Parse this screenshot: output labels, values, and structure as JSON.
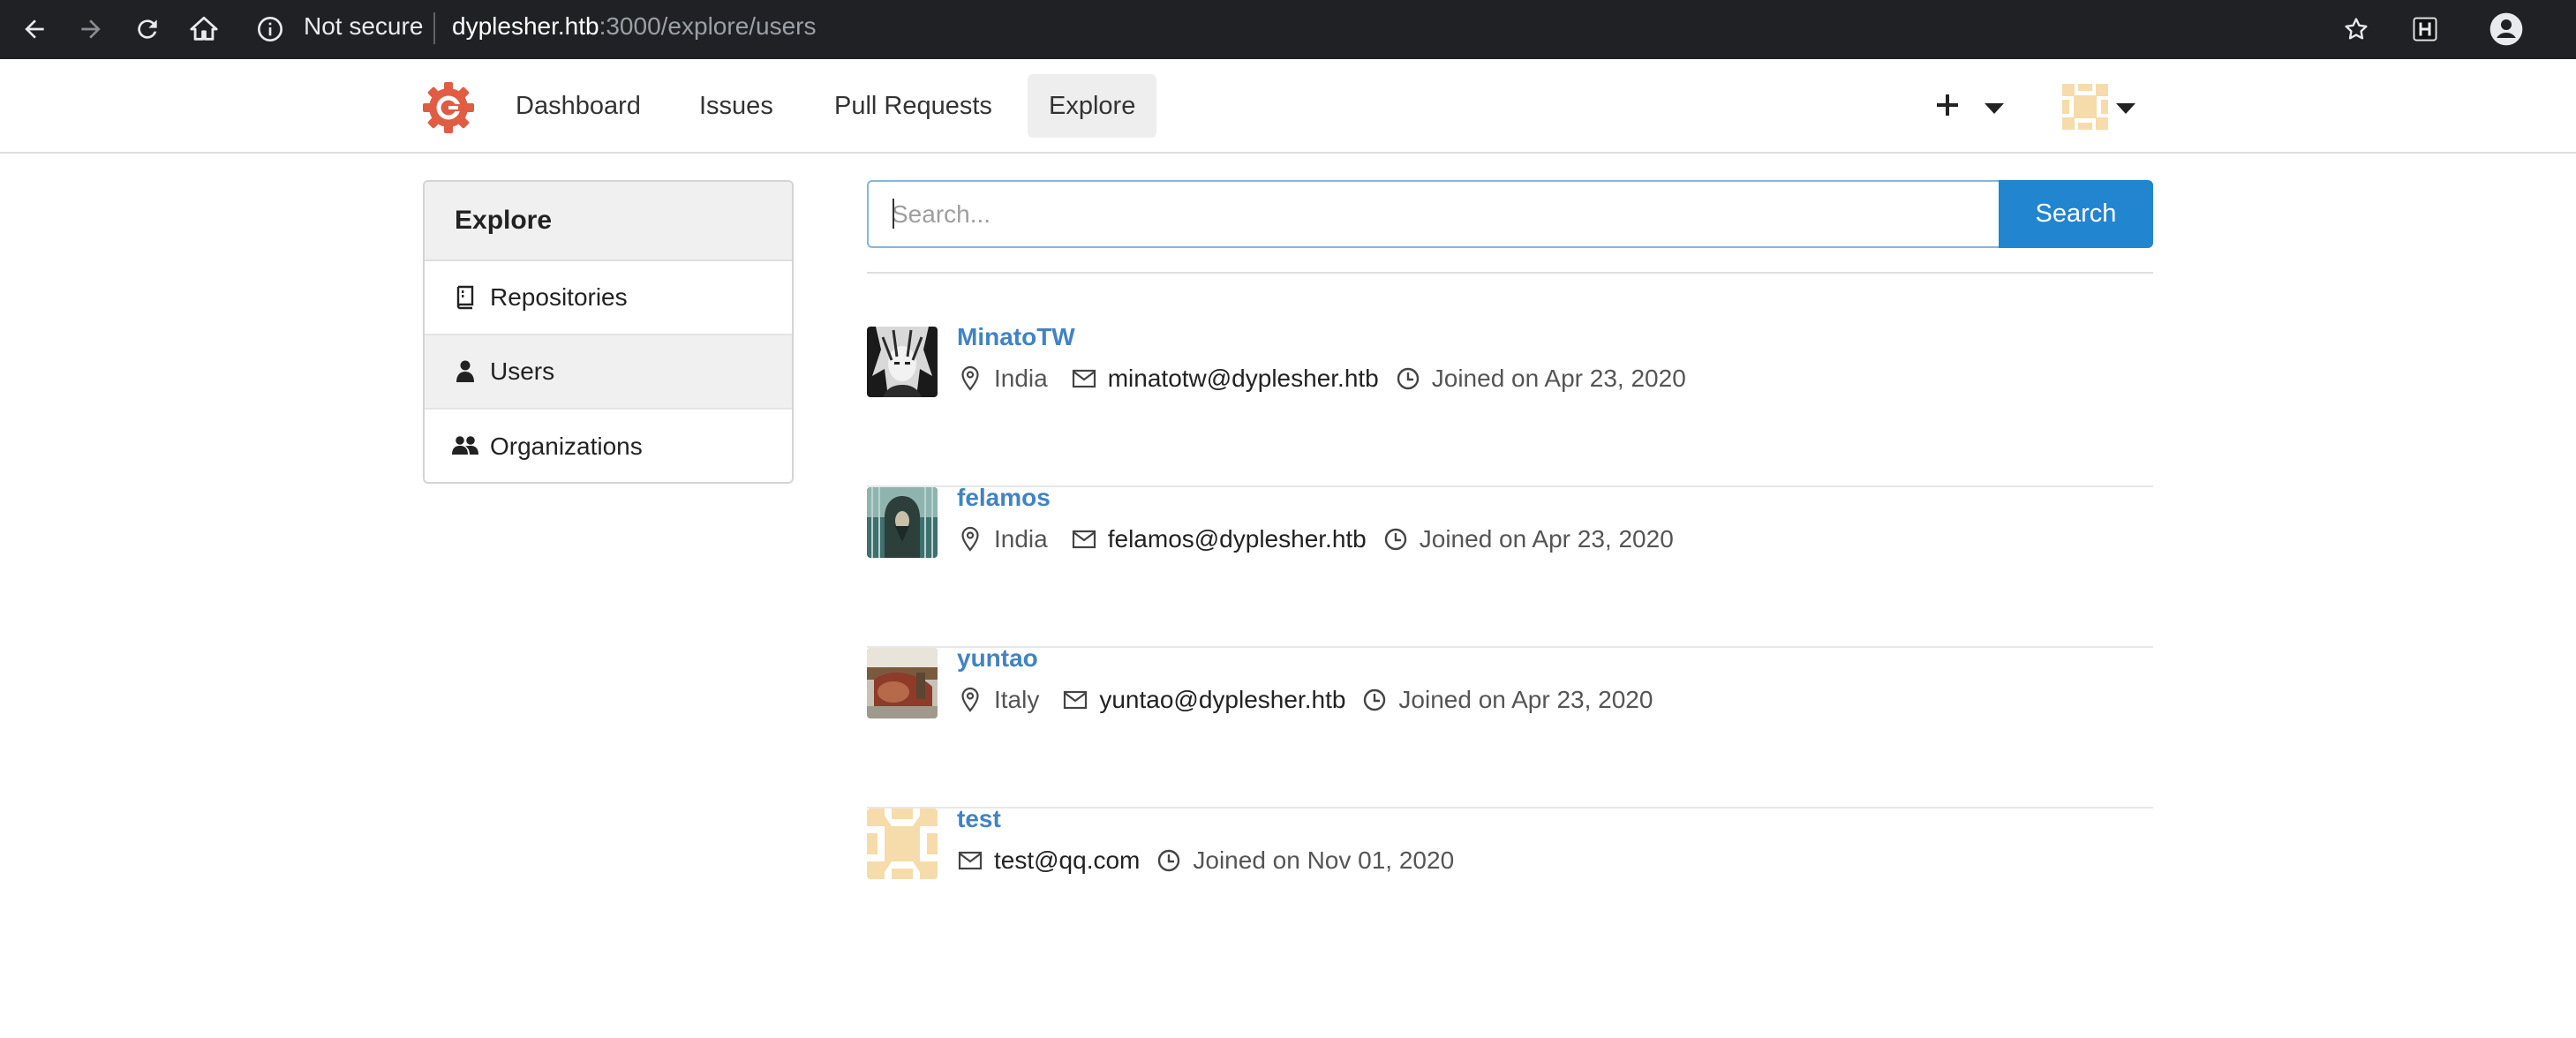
{
  "browser": {
    "security_label": "Not secure",
    "url_host": "dyplesher.htb",
    "url_path": ":3000/explore/users"
  },
  "navbar": {
    "items": [
      {
        "label": "Dashboard"
      },
      {
        "label": "Issues"
      },
      {
        "label": "Pull Requests"
      },
      {
        "label": "Explore"
      }
    ],
    "plus_symbol": "+"
  },
  "sidebar": {
    "title": "Explore",
    "items": [
      {
        "label": "Repositories",
        "icon": "book-icon"
      },
      {
        "label": "Users",
        "icon": "person-icon"
      },
      {
        "label": "Organizations",
        "icon": "people-icon"
      }
    ],
    "active_index": 1
  },
  "search": {
    "placeholder": "Search...",
    "button_label": "Search"
  },
  "users": [
    {
      "name": "MinatoTW",
      "location": "India",
      "email": "minatotw@dyplesher.htb",
      "joined": "Joined on Apr 23, 2020"
    },
    {
      "name": "felamos",
      "location": "India",
      "email": "felamos@dyplesher.htb",
      "joined": "Joined on Apr 23, 2020"
    },
    {
      "name": "yuntao",
      "location": "Italy",
      "email": "yuntao@dyplesher.htb",
      "joined": "Joined on Apr 23, 2020"
    },
    {
      "name": "test",
      "location": "",
      "email": "test@qq.com",
      "joined": "Joined on Nov 01, 2020"
    }
  ],
  "colors": {
    "accent": "#2185d0",
    "link": "#4183c4",
    "logo": "#e05d44"
  }
}
